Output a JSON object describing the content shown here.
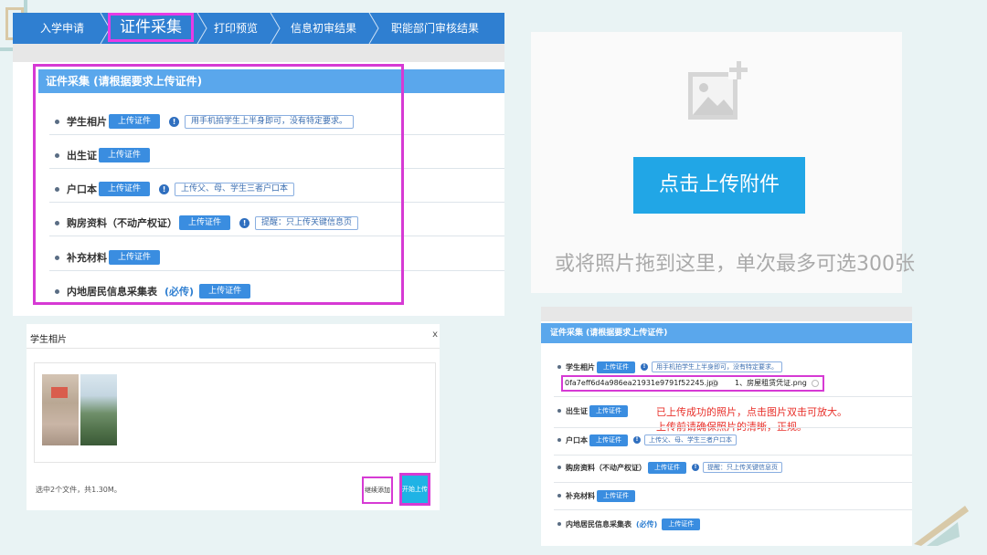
{
  "panel_top_left": {
    "nav": {
      "items": [
        "入学申请",
        "证件采集",
        "打印预览",
        "信息初审结果",
        "职能部门审核结果"
      ],
      "active": "证件采集"
    },
    "section_title": "证件采集 (请根据要求上传证件)",
    "upload_label": "上传证件",
    "rows": [
      {
        "label": "学生相片",
        "tip": "用手机拍学生上半身即可，没有特定要求。"
      },
      {
        "label": "出生证"
      },
      {
        "label": "户口本",
        "tip": "上传父、母、学生三者户口本"
      },
      {
        "label": "购房资料（不动产权证）",
        "tip": "提醒：只上传关键信息页"
      },
      {
        "label": "补充材料"
      },
      {
        "label": "内地居民信息采集表",
        "required": "(必传)"
      }
    ]
  },
  "panel_upload": {
    "button": "点击上传附件",
    "hint": "或将照片拖到这里，单次最多可选300张",
    "icon": "add-image-icon"
  },
  "panel_dialog": {
    "title": "学生相片",
    "close": "x",
    "footer": "选中2个文件，共1.30M。",
    "continue_button": "继续添加",
    "start_button": "开始上传"
  },
  "panel_result": {
    "section_title": "证件采集 (请根据要求上传证件)",
    "upload_label": "上传证件",
    "file1": "0fa7eff6d4a986ea21931e9791f52245.jpg",
    "file2": "1、房屋租赁凭证.png",
    "note_line1": "已上传成功的照片，点击图片双击可放大。",
    "note_line2": "上传前请确保照片的清晰，正规。",
    "rows": [
      {
        "label": "学生相片",
        "tip": "用手机拍学生上半身即可，没有特定要求。"
      },
      {
        "label": "出生证"
      },
      {
        "label": "户口本",
        "tip": "上传父、母、学生三者户口本"
      },
      {
        "label": "购房资料（不动产权证）",
        "tip": "提醒：只上传关键信息页"
      },
      {
        "label": "补充材料"
      },
      {
        "label": "内地居民信息采集表",
        "required": "(必传)"
      }
    ]
  },
  "colors": {
    "nav_blue": "#2f7fd1",
    "header_blue": "#5aa7ec",
    "highlight_magenta": "#d63ad4",
    "upload_button": "#21a6e6",
    "note_red": "#e8302a"
  }
}
